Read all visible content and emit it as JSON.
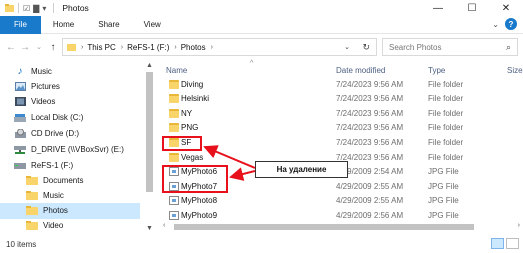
{
  "window": {
    "title": "Photos",
    "controls": {
      "minimize": "—",
      "maximize": "☐",
      "close": "✕"
    }
  },
  "ribbon": {
    "tabs": [
      "File",
      "Home",
      "Share",
      "View"
    ],
    "help": "?"
  },
  "address": {
    "crumbs": [
      "This PC",
      "ReFS-1 (F:)",
      "Photos"
    ],
    "search_placeholder": "Search Photos"
  },
  "nav": {
    "items": [
      {
        "label": "Music",
        "icon": "music-icon"
      },
      {
        "label": "Pictures",
        "icon": "pictures-icon"
      },
      {
        "label": "Videos",
        "icon": "videos-icon"
      },
      {
        "label": "Local Disk (C:)",
        "icon": "drive-icon"
      },
      {
        "label": "CD Drive (D:)",
        "icon": "cd-icon"
      },
      {
        "label": "D_DRIVE (\\\\VBoxSvr) (E:)",
        "icon": "network-drive-icon"
      },
      {
        "label": "ReFS-1 (F:)",
        "icon": "drive-icon"
      },
      {
        "label": "Documents",
        "icon": "folder-icon"
      },
      {
        "label": "Music",
        "icon": "folder-icon"
      },
      {
        "label": "Photos",
        "icon": "folder-icon",
        "selected": true
      },
      {
        "label": "Video",
        "icon": "folder-icon"
      }
    ]
  },
  "list": {
    "columns": {
      "name": "Name",
      "date": "Date modified",
      "type": "Type",
      "size": "Size"
    },
    "rows": [
      {
        "name": "Diving",
        "date": "7/24/2023 9:56 AM",
        "type": "File folder",
        "kind": "folder"
      },
      {
        "name": "Helsinki",
        "date": "7/24/2023 9:56 AM",
        "type": "File folder",
        "kind": "folder"
      },
      {
        "name": "NY",
        "date": "7/24/2023 9:56 AM",
        "type": "File folder",
        "kind": "folder"
      },
      {
        "name": "PNG",
        "date": "7/24/2023 9:56 AM",
        "type": "File folder",
        "kind": "folder"
      },
      {
        "name": "SF",
        "date": "7/24/2023 9:56 AM",
        "type": "File folder",
        "kind": "folder"
      },
      {
        "name": "Vegas",
        "date": "7/24/2023 9:56 AM",
        "type": "File folder",
        "kind": "folder"
      },
      {
        "name": "MyPhoto6",
        "date": "4/29/2009 2:54 AM",
        "type": "JPG File",
        "kind": "jpg"
      },
      {
        "name": "MyPhoto7",
        "date": "4/29/2009 2:55 AM",
        "type": "JPG File",
        "kind": "jpg"
      },
      {
        "name": "MyPhoto8",
        "date": "4/29/2009 2:55 AM",
        "type": "JPG File",
        "kind": "jpg"
      },
      {
        "name": "MyPhoto9",
        "date": "4/29/2009 2:56 AM",
        "type": "JPG File",
        "kind": "jpg"
      }
    ]
  },
  "annotation": {
    "label": "На удаление",
    "color": "#e8101a"
  },
  "status": {
    "count": "10 items"
  }
}
